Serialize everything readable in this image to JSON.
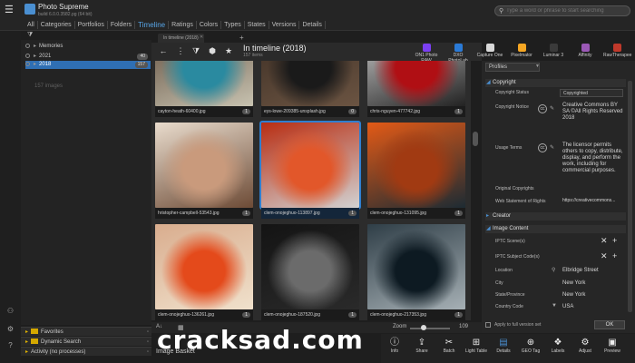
{
  "app": {
    "title": "Photo Supreme",
    "build": "build 6.0.0.3582.pg (64 bit)"
  },
  "search": {
    "placeholder": "Type a word or phrase to start searching"
  },
  "tabs": [
    "All",
    "Categories",
    "Portfolios",
    "Folders",
    "Timeline",
    "Ratings",
    "Colors",
    "Types",
    "States",
    "Versions",
    "Details"
  ],
  "active_tab_index": 4,
  "tree": [
    {
      "label": "Memories",
      "count": ""
    },
    {
      "label": "2021",
      "count": "40"
    },
    {
      "label": "2018",
      "count": "157"
    }
  ],
  "images_hint": "157 images",
  "accordions": [
    {
      "label": "Favorites"
    },
    {
      "label": "Dynamic Search"
    },
    {
      "label": "Activity (no processes)"
    }
  ],
  "breadcrumb": "In timeline (2018)",
  "view": {
    "title": "In timeline (2018)",
    "count": "157 items"
  },
  "plugins": [
    {
      "label": "ON1 Photo RAW",
      "color": "#7b3ff2"
    },
    {
      "label": "DXO PhotoLab",
      "color": "#2a7ad6"
    },
    {
      "label": "Capture One",
      "color": "#d8d8d8"
    },
    {
      "label": "Pixelmator",
      "color": "#f5a623"
    },
    {
      "label": "Luminar 3",
      "color": "#3a3a3a"
    },
    {
      "label": "Affinity",
      "color": "#9b59b6"
    },
    {
      "label": "RawTherapee",
      "color": "#c0392b"
    }
  ],
  "thumbnails": [
    {
      "name": "cayton-heath-60400.jpg",
      "badge": "1",
      "colors": [
        "#5c4838",
        "#2a8aa0",
        "#c7c2b0"
      ]
    },
    {
      "name": "eys-lowe-209385-unsplash.jpg",
      "badge": "0",
      "colors": [
        "#3a2c22",
        "#1a1a1a",
        "#6b5442"
      ]
    },
    {
      "name": "chris-nguyen-477742.jpg",
      "badge": "1",
      "colors": [
        "#d9d9d9",
        "#b00f14",
        "#222"
      ]
    },
    {
      "name": "hristopher-campbell-53543.jpg",
      "badge": "1",
      "colors": [
        "#e9dccd",
        "#c99a7c",
        "#6d4b36"
      ]
    },
    {
      "name": "clem-onojeghuo-113897.jpg",
      "badge": "1",
      "colors": [
        "#b82d12",
        "#e2572a",
        "#d2d2d2"
      ]
    },
    {
      "name": "clem-onojeghuo-131095.jpg",
      "badge": "1",
      "colors": [
        "#e35a16",
        "#a13a12",
        "#1d2b33"
      ]
    },
    {
      "name": "clem-onojeghuo-136261.jpg",
      "badge": "1",
      "colors": [
        "#d9ad8e",
        "#e44a1b",
        "#f0e1cc"
      ]
    },
    {
      "name": "clem-onojeghuo-187520.jpg",
      "badge": "1",
      "colors": [
        "#141414",
        "#6b6b6b",
        "#2a2a2a"
      ]
    },
    {
      "name": "clem-onojeghuo-217353.jpg",
      "badge": "1",
      "colors": [
        "#2f3e47",
        "#0d1a22",
        "#a6b0b5"
      ]
    }
  ],
  "grid_footer": {
    "zoom_label": "Zoom",
    "zoom_value": "109",
    "zoom_level": 0.35,
    "image_basket": "Image Basket"
  },
  "right_panel": {
    "profile": "Profiles",
    "sections": {
      "copyright": "Copyright",
      "creator": "Creator",
      "image_content": "Image Content"
    },
    "fields": {
      "copyright_status_label": "Copyright Status",
      "copyright_status_value": "Copyrighted",
      "copyright_notice_label": "Copyright Notice",
      "copyright_notice_value": "Creative Commons BY SA ©All Rights Reserved 2018",
      "usage_terms_label": "Usage Terms",
      "usage_terms_value": "The licensor permits others to copy, distribute, display, and perform the work, including for commercial purposes.",
      "original_copyrights_label": "Original Copyrights",
      "web_statement_label": "Web Statement of Rights",
      "web_statement_value": "https://creativecommons...",
      "iptc_scenes_label": "IPTC Scene(s)",
      "iptc_subject_label": "IPTC Subject Code(s)",
      "location_label": "Location",
      "location_value": "Elbridge Street",
      "city_label": "City",
      "city_value": "New York",
      "state_label": "State/Province",
      "state_value": "New York",
      "country_label": "Country Code",
      "country_value": "USA"
    },
    "apply_label": "Apply to full version set",
    "ok_label": "OK"
  },
  "bottom_bar": [
    {
      "label": "Info",
      "icon": "info-icon",
      "glyph": "ⓘ"
    },
    {
      "label": "Share",
      "icon": "share-icon",
      "glyph": "⇪"
    },
    {
      "label": "Batch",
      "icon": "batch-icon",
      "glyph": "✂"
    },
    {
      "label": "Light Table",
      "icon": "light-table-icon",
      "glyph": "⊞"
    },
    {
      "label": "Details",
      "icon": "details-icon",
      "glyph": "▤"
    },
    {
      "label": "GEO Tag",
      "icon": "geo-tag-icon",
      "glyph": "⊕"
    },
    {
      "label": "Labels",
      "icon": "labels-icon",
      "glyph": "❖"
    },
    {
      "label": "Adjust",
      "icon": "adjust-icon",
      "glyph": "⚙"
    },
    {
      "label": "Preview",
      "icon": "preview-icon",
      "glyph": "▣"
    }
  ],
  "bottom_bar_active_index": 4,
  "watermark": "cracksad.com"
}
